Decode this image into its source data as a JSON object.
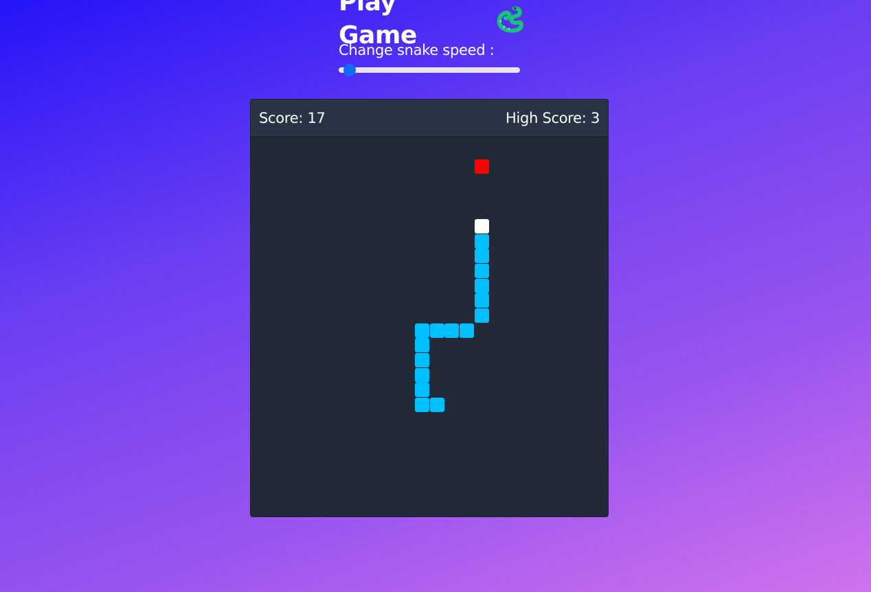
{
  "header": {
    "title": "Play Game",
    "icon": "snake-icon",
    "speed_label": "Change snake speed :",
    "speed_slider_level": 0.03
  },
  "game": {
    "score_text": "Score: 17",
    "high_score_text": "High Score: 3",
    "grid": {
      "cols": 24,
      "rows": 25
    },
    "food": [
      15,
      1
    ],
    "snake_head": [
      15,
      5
    ],
    "snake_body": [
      [
        15,
        6
      ],
      [
        15,
        7
      ],
      [
        15,
        8
      ],
      [
        15,
        9
      ],
      [
        15,
        10
      ],
      [
        15,
        11
      ],
      [
        14,
        12
      ],
      [
        13,
        12
      ],
      [
        12,
        12
      ],
      [
        11,
        12
      ],
      [
        11,
        13
      ],
      [
        11,
        14
      ],
      [
        11,
        15
      ],
      [
        11,
        16
      ],
      [
        11,
        17
      ],
      [
        12,
        17
      ]
    ],
    "colors": {
      "food": "#ff0000",
      "head": "#ffffff",
      "body": "#00bfff",
      "board": "#222a38"
    }
  }
}
